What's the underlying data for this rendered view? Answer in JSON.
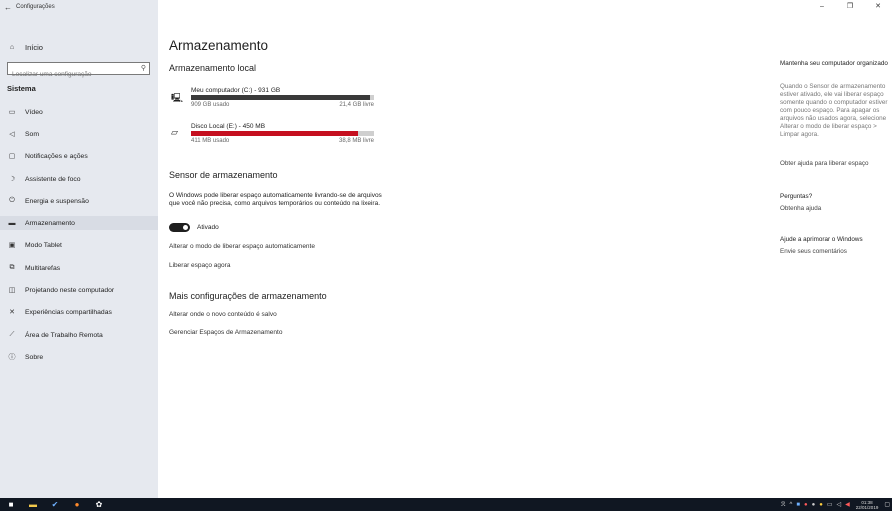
{
  "window": {
    "title": "Configurações",
    "controls": {
      "minimize": "–",
      "maximize": "❐",
      "close": "✕"
    }
  },
  "sidebar": {
    "home": "Início",
    "search_placeholder": "Localizar uma configuração",
    "section": "Sistema",
    "items": [
      {
        "label": "Vídeo",
        "icon": "monitor-icon"
      },
      {
        "label": "Som",
        "icon": "speaker-icon"
      },
      {
        "label": "Notificações e ações",
        "icon": "notifications-icon"
      },
      {
        "label": "Assistente de foco",
        "icon": "moon-icon"
      },
      {
        "label": "Energia e suspensão",
        "icon": "power-icon"
      },
      {
        "label": "Armazenamento",
        "icon": "storage-icon"
      },
      {
        "label": "Modo Tablet",
        "icon": "tablet-icon"
      },
      {
        "label": "Multitarefas",
        "icon": "multitask-icon"
      },
      {
        "label": "Projetando neste computador",
        "icon": "projector-icon"
      },
      {
        "label": "Experiências compartilhadas",
        "icon": "shared-icon"
      },
      {
        "label": "Área de Trabalho Remota",
        "icon": "remote-icon"
      },
      {
        "label": "Sobre",
        "icon": "info-icon"
      }
    ],
    "active_index": 5
  },
  "main": {
    "title": "Armazenamento",
    "local_storage_heading": "Armazenamento local",
    "drives": [
      {
        "name": "Meu computador (C:) - 931 GB",
        "used": "909 GB usado",
        "free": "21,4 GB livre",
        "fill_fraction": 0.976,
        "fill_color": "#3a3a3a",
        "icon": "pc-drive-icon"
      },
      {
        "name": "Disco Local (E:) - 450 MB",
        "used": "411 MB usado",
        "free": "38,8 MB livre",
        "fill_fraction": 0.913,
        "fill_color": "#c50f1f",
        "icon": "disk-drive-icon"
      }
    ],
    "sensor_heading": "Sensor de armazenamento",
    "sensor_description": "O Windows pode liberar espaço automaticamente livrando-se de arquivos que você não precisa, como arquivos temporários ou conteúdo na lixeira.",
    "toggle_label": "Ativado",
    "link_change_mode": "Alterar o modo de liberar espaço automaticamente",
    "link_free_now": "Liberar espaço agora",
    "more_heading": "Mais configurações de armazenamento",
    "link_change_save": "Alterar onde o novo conteúdo é salvo",
    "link_manage_spaces": "Gerenciar Espaços de Armazenamento"
  },
  "right": {
    "title1": "Mantenha seu computador organizado",
    "para1": "Quando o Sensor de armazenamento estiver ativado, ele vai liberar espaço somente quando o computador estiver com pouco espaço. Para apagar os arquivos não usados agora, selecione Alterar o modo de liberar espaço > Limpar agora.",
    "link1": "Obter ajuda para liberar espaço",
    "title2": "Perguntas?",
    "link2": "Obtenha ajuda",
    "title3": "Ajude a aprimorar o Windows",
    "link3": "Envie seus comentários"
  },
  "taskbar": {
    "clock_time": "01:38",
    "clock_date": "22/01/2019"
  }
}
